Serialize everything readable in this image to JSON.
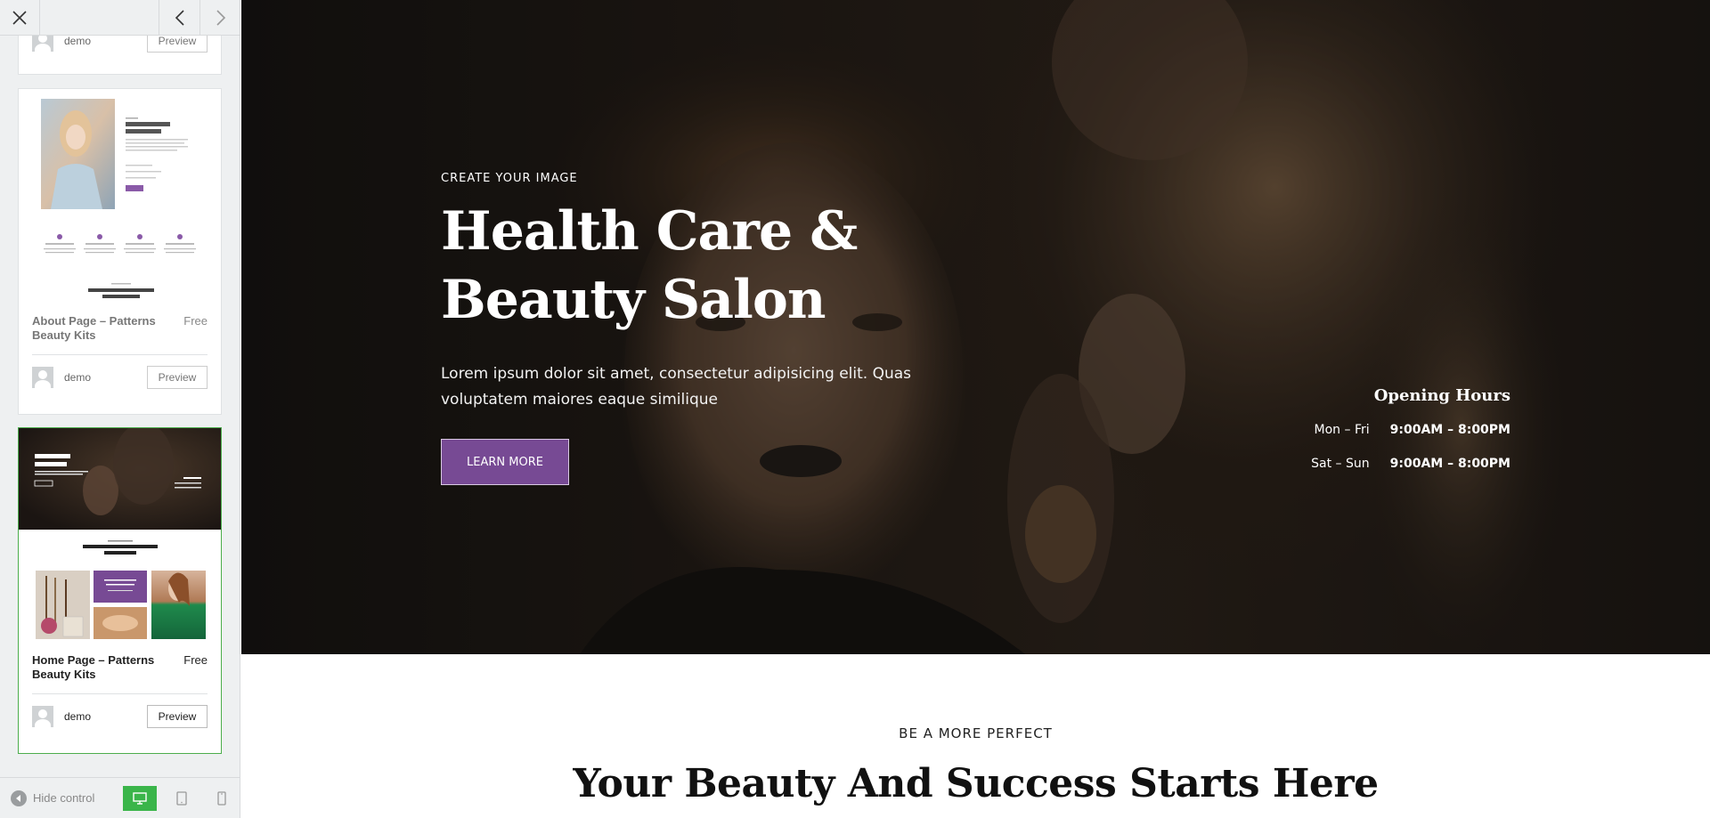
{
  "sidebar": {
    "top_card": {
      "author": "demo",
      "preview_label": "Preview"
    },
    "cards": [
      {
        "title": "About Page – Patterns Beauty Kits",
        "price": "Free",
        "author": "demo",
        "preview_label": "Preview",
        "thumb": {
          "title": "Quality & Natural Beauty Salon",
          "footer": "Your Beauty And Success Starts Here",
          "services": [
            "Cutting & Styling",
            "Nail Extensions",
            "Hair Care",
            "Relaxing Massage"
          ]
        }
      },
      {
        "title": "Home Page – Patterns Beauty Kits",
        "price": "Free",
        "author": "demo",
        "preview_label": "Preview",
        "thumb": {
          "hero_title": "Health Care & Beauty Salon",
          "section_title": "Your Beauty And Success Starts Here",
          "promo_text": "Treat Self Confidence To Your Beauty"
        }
      }
    ],
    "bottom": {
      "hide_control_label": "Hide control"
    },
    "accent_color": "#3ab54a"
  },
  "hero": {
    "eyebrow": "CREATE YOUR IMAGE",
    "title_line1": "Health Care &",
    "title_line2": "Beauty Salon",
    "text": "Lorem ipsum dolor sit amet, consectetur adipisicing elit. Quas voluptatem maiores eaque similique",
    "button_label": "LEARN MORE",
    "button_color": "#774a94",
    "hours": {
      "title": "Opening Hours",
      "rows": [
        {
          "day": "Mon – Fri",
          "time": "9:00AM – 8:00PM"
        },
        {
          "day": "Sat – Sun",
          "time": "9:00AM – 8:00PM"
        }
      ]
    }
  },
  "section2": {
    "eyebrow": "BE A MORE PERFECT",
    "title": "Your Beauty And Success Starts Here"
  }
}
